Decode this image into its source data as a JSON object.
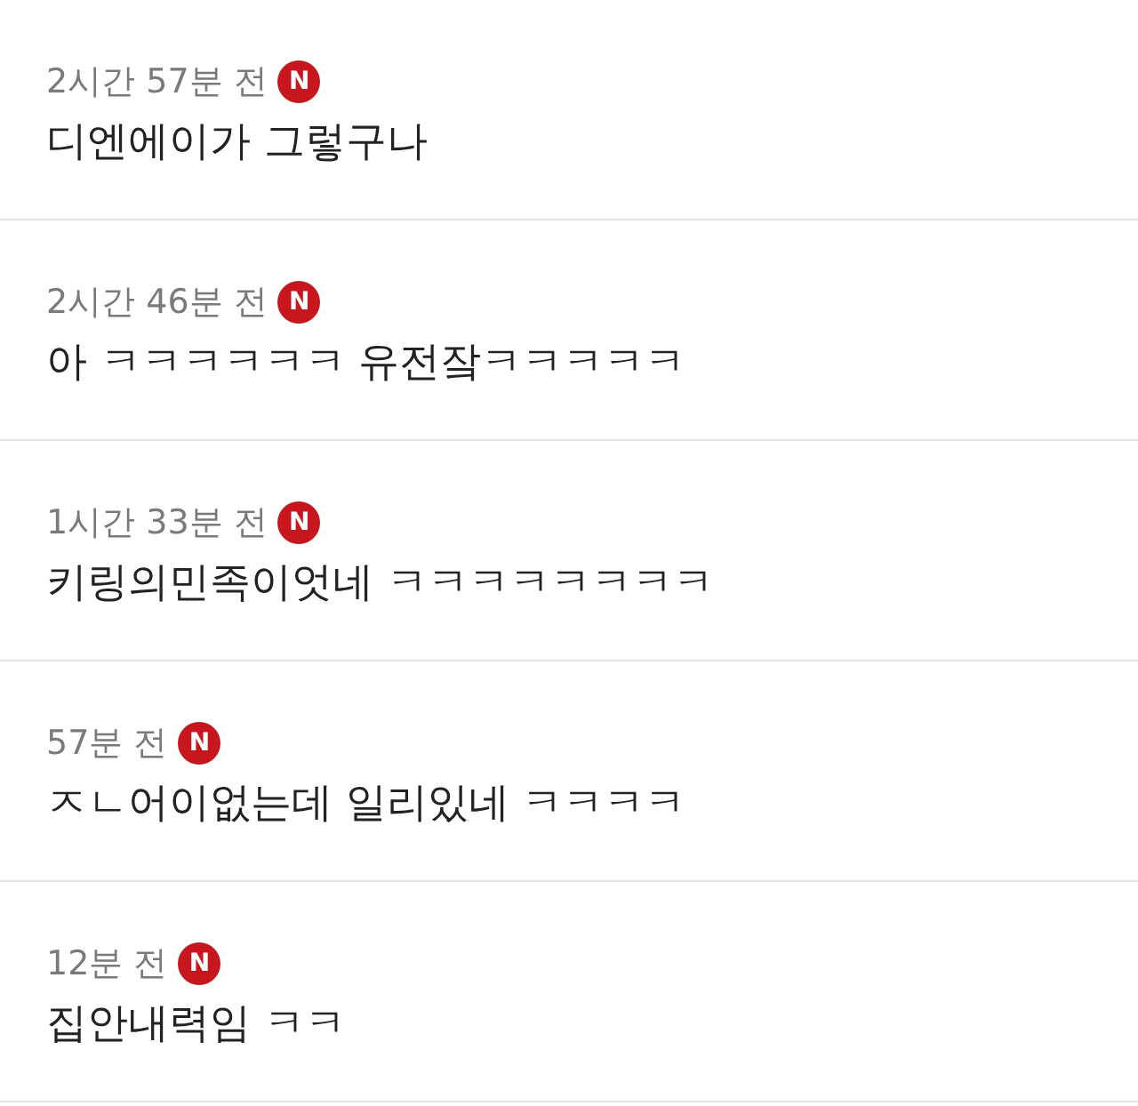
{
  "comments": [
    {
      "time": "2시간 57분 전",
      "badge": "N",
      "text": "디엔에이가 그렇구나"
    },
    {
      "time": "2시간 46분 전",
      "badge": "N",
      "text": "아 ㅋㅋㅋㅋㅋㅋ 유전잨ㅋㅋㅋㅋㅋ"
    },
    {
      "time": "1시간 33분 전",
      "badge": "N",
      "text": "키링의민족이엇네 ㅋㅋㅋㅋㅋㅋㅋㅋ"
    },
    {
      "time": "57분 전",
      "badge": "N",
      "text": "ㅈㄴ어이없는데 일리있네 ㅋㅋㅋㅋ"
    },
    {
      "time": "12분 전",
      "badge": "N",
      "text": "집안내력임 ㅋㅋ"
    }
  ]
}
